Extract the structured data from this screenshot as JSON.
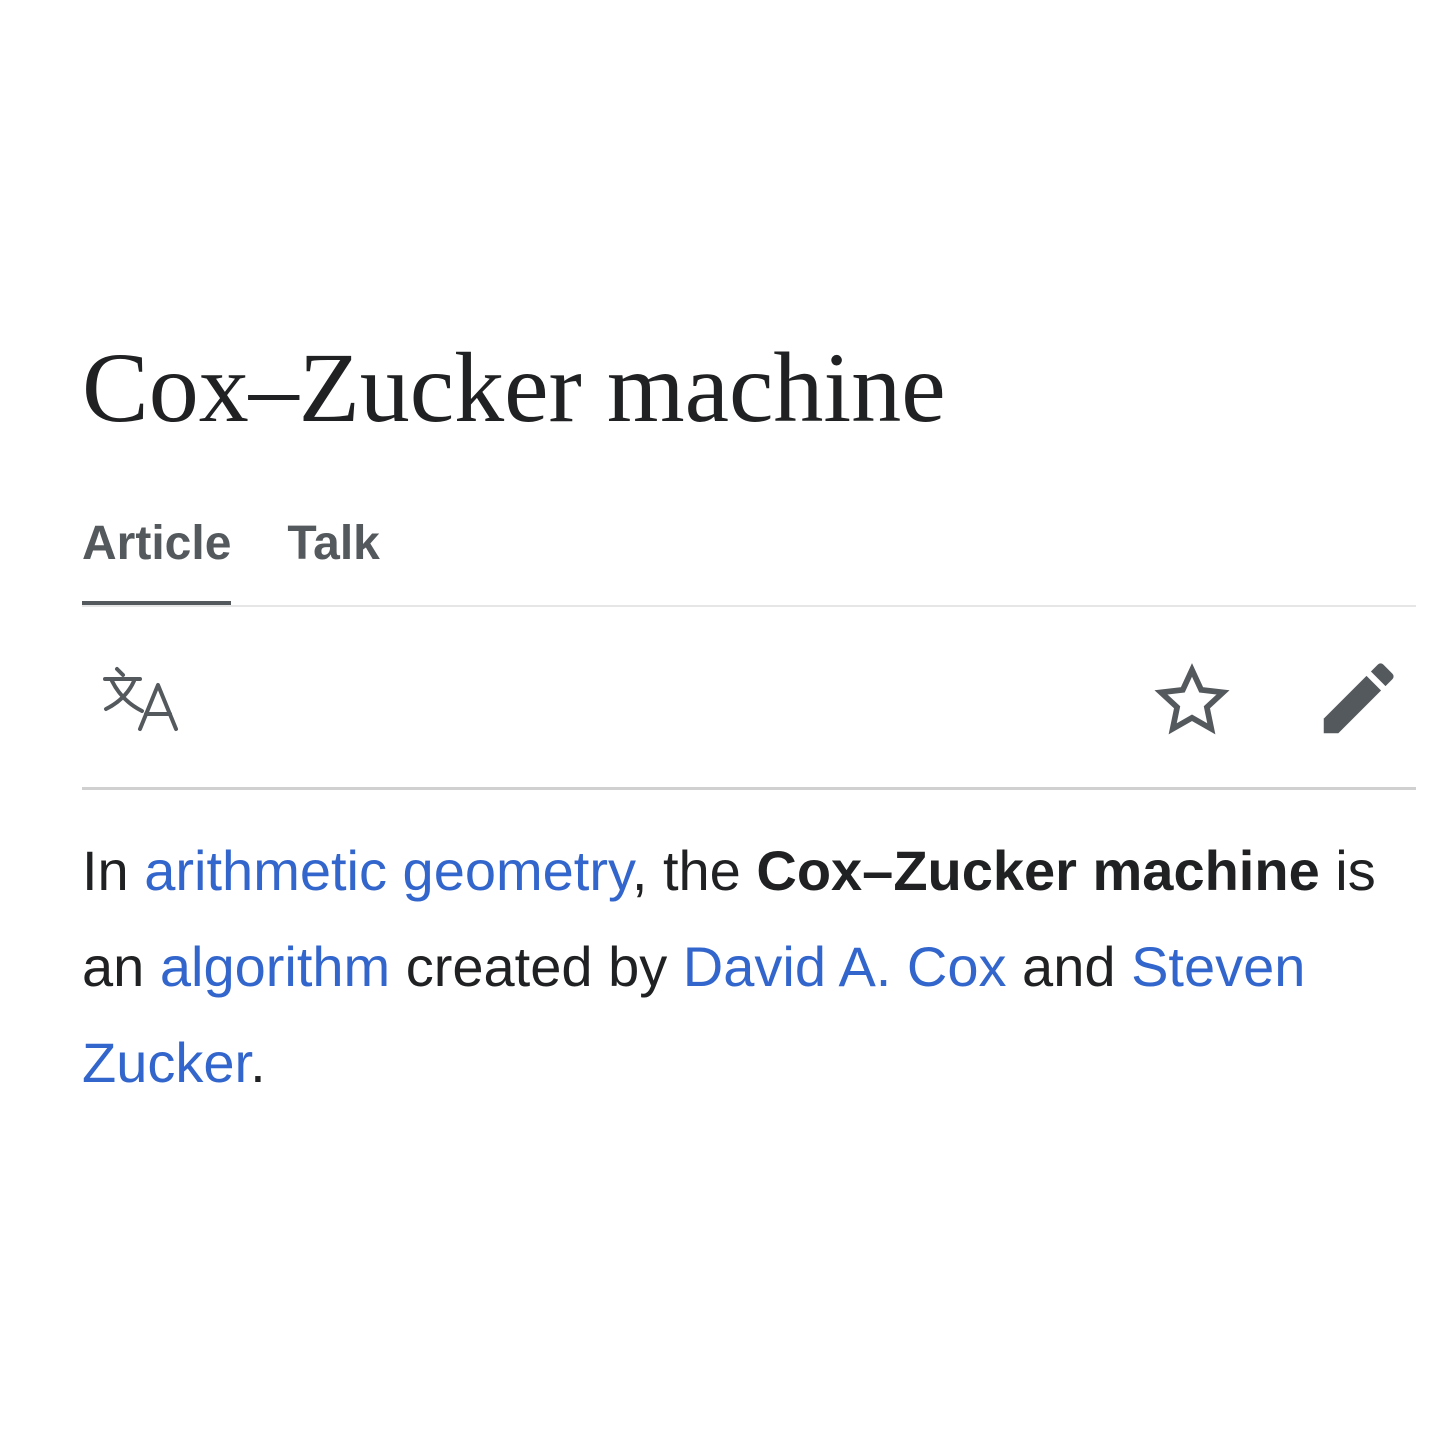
{
  "article": {
    "title": "Cox–Zucker machine",
    "tabs": [
      {
        "label": "Article",
        "active": true
      },
      {
        "label": "Talk",
        "active": false
      }
    ],
    "toolbar": {
      "icons": [
        "translate-icon",
        "star-icon",
        "pencil-icon"
      ]
    },
    "body": {
      "t1": "In ",
      "link1": "arithmetic geometry",
      "t2": ", the ",
      "bold": "Cox–Zucker machine",
      "t3": " is an ",
      "link2": "algorithm",
      "t4": " created by ",
      "link3": "David A. Cox",
      "t5": " and ",
      "link4": "Steven Zucker",
      "t6": "."
    }
  },
  "colors": {
    "link": "#3366cc",
    "text": "#202122",
    "tab": "#54595d",
    "icon": "#54595d"
  }
}
